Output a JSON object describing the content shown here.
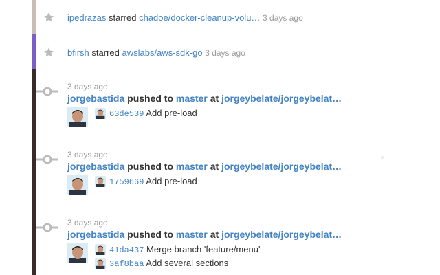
{
  "colors": {
    "link": "#4183c4",
    "muted": "#999999",
    "stripe_tan": "#c8beb3",
    "stripe_purple": "#7b5fc7",
    "stripe_dark": "#3a2a2a",
    "icon": "#bbbbbb"
  },
  "feed": {
    "stars": [
      {
        "icon": "star-icon",
        "user": "ipedrazas",
        "action": "starred",
        "repo": "chadoe/docker-cleanup-volu…",
        "time": "3 days ago"
      },
      {
        "icon": "star-icon",
        "user": "bfirsh",
        "action": "starred",
        "repo": "awslabs/aws-sdk-go",
        "time": "3 days ago"
      }
    ],
    "pushes": [
      {
        "icon": "git-commit-icon",
        "time": "3 days ago",
        "user": "jorgebastida",
        "action": "pushed to",
        "branch": "master",
        "at": "at",
        "repo": "jorgeybelate/jorgeybelat…",
        "commits": [
          {
            "sha": "63de539",
            "message": "Add pre-load"
          }
        ]
      },
      {
        "icon": "git-commit-icon",
        "time": "3 days ago",
        "user": "jorgebastida",
        "action": "pushed to",
        "branch": "master",
        "at": "at",
        "repo": "jorgeybelate/jorgeybelat…",
        "commits": [
          {
            "sha": "1759669",
            "message": "Add pre-load"
          }
        ]
      },
      {
        "icon": "git-commit-icon",
        "time": "3 days ago",
        "user": "jorgebastida",
        "action": "pushed to",
        "branch": "master",
        "at": "at",
        "repo": "jorgeybelate/jorgeybelat…",
        "commits": [
          {
            "sha": "41da437",
            "message": "Merge branch 'feature/menu'"
          },
          {
            "sha": "3af8baa",
            "message": "Add several sections"
          }
        ]
      }
    ]
  }
}
